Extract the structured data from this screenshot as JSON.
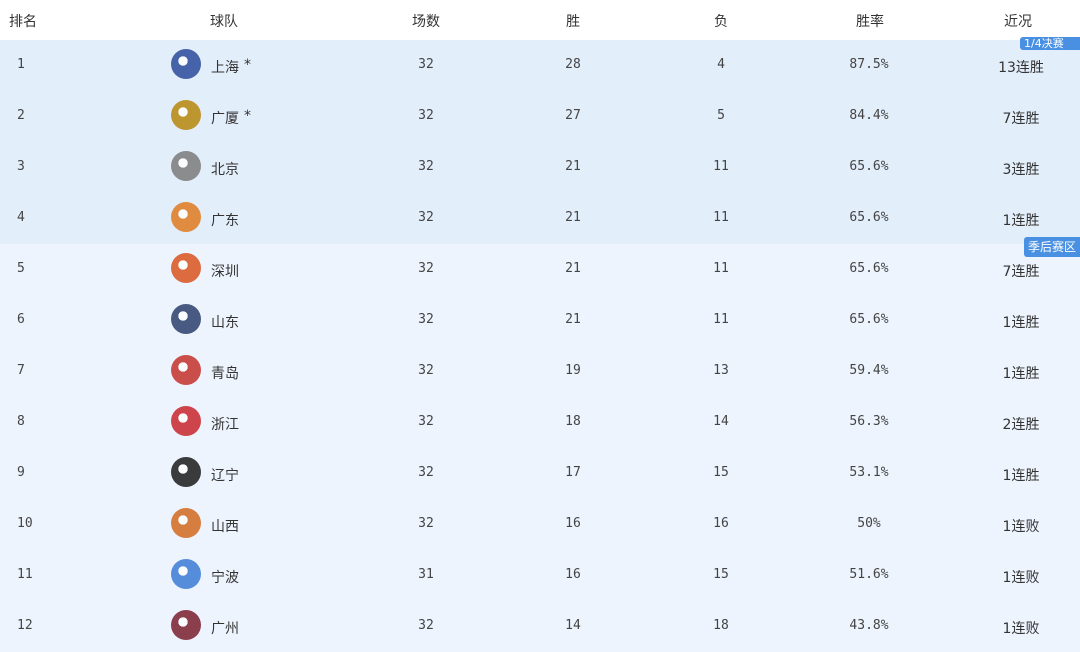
{
  "header": {
    "rank": "排名",
    "team": "球队",
    "games": "场数",
    "wins": "胜",
    "losses": "负",
    "win_pct": "胜率",
    "recent": "近况"
  },
  "zone_tags": {
    "top": "1/4决赛",
    "playoff": "季后赛区"
  },
  "colors": {
    "top_zone_bg": "#e3eefb",
    "playoff_zone_bg": "#edf4fd",
    "tag_bg": "#4a90e2"
  },
  "rows": [
    {
      "rank": "1",
      "team": "上海",
      "mark": "*",
      "games": "32",
      "wins": "28",
      "losses": "4",
      "pct": "87.5%",
      "streak": "13连胜",
      "logo": "sharks-logo",
      "logo_color": "#2a4a9a"
    },
    {
      "rank": "2",
      "team": "广厦",
      "mark": "*",
      "games": "32",
      "wins": "27",
      "losses": "5",
      "pct": "84.4%",
      "streak": "7连胜",
      "logo": "lions-logo",
      "logo_color": "#b8860b"
    },
    {
      "rank": "3",
      "team": "北京",
      "mark": "",
      "games": "32",
      "wins": "21",
      "losses": "11",
      "pct": "65.6%",
      "streak": "3连胜",
      "logo": "ducks-logo",
      "logo_color": "#7a7a7a"
    },
    {
      "rank": "4",
      "team": "广东",
      "mark": "",
      "games": "32",
      "wins": "21",
      "losses": "11",
      "pct": "65.6%",
      "streak": "1连胜",
      "logo": "tigers-logo",
      "logo_color": "#e07a1f"
    },
    {
      "rank": "5",
      "team": "深圳",
      "mark": "",
      "games": "32",
      "wins": "21",
      "losses": "11",
      "pct": "65.6%",
      "streak": "7连胜",
      "logo": "leopards-logo",
      "logo_color": "#d9531e"
    },
    {
      "rank": "6",
      "team": "山东",
      "mark": "",
      "games": "32",
      "wins": "21",
      "losses": "11",
      "pct": "65.6%",
      "streak": "1连胜",
      "logo": "heroes-logo",
      "logo_color": "#2b3f6b"
    },
    {
      "rank": "7",
      "team": "青岛",
      "mark": "",
      "games": "32",
      "wins": "19",
      "losses": "13",
      "pct": "59.4%",
      "streak": "1连胜",
      "logo": "eagles-logo",
      "logo_color": "#c4302b"
    },
    {
      "rank": "8",
      "team": "浙江",
      "mark": "",
      "games": "32",
      "wins": "18",
      "losses": "14",
      "pct": "56.3%",
      "streak": "2连胜",
      "logo": "golden-bulls-logo",
      "logo_color": "#c8252c"
    },
    {
      "rank": "9",
      "team": "辽宁",
      "mark": "",
      "games": "32",
      "wins": "17",
      "losses": "15",
      "pct": "53.1%",
      "streak": "1连胜",
      "logo": "flying-leopards-logo",
      "logo_color": "#1a1a1a"
    },
    {
      "rank": "10",
      "team": "山西",
      "mark": "",
      "games": "32",
      "wins": "16",
      "losses": "16",
      "pct": "50%",
      "streak": "1连败",
      "logo": "dragons-logo",
      "logo_color": "#d2691e"
    },
    {
      "rank": "11",
      "team": "宁波",
      "mark": "",
      "games": "31",
      "wins": "16",
      "losses": "15",
      "pct": "51.6%",
      "streak": "1连败",
      "logo": "rockets-logo",
      "logo_color": "#3a7bd5"
    },
    {
      "rank": "12",
      "team": "广州",
      "mark": "",
      "games": "32",
      "wins": "14",
      "losses": "18",
      "pct": "43.8%",
      "streak": "1连败",
      "logo": "loong-lions-logo",
      "logo_color": "#7a1f2e"
    }
  ]
}
